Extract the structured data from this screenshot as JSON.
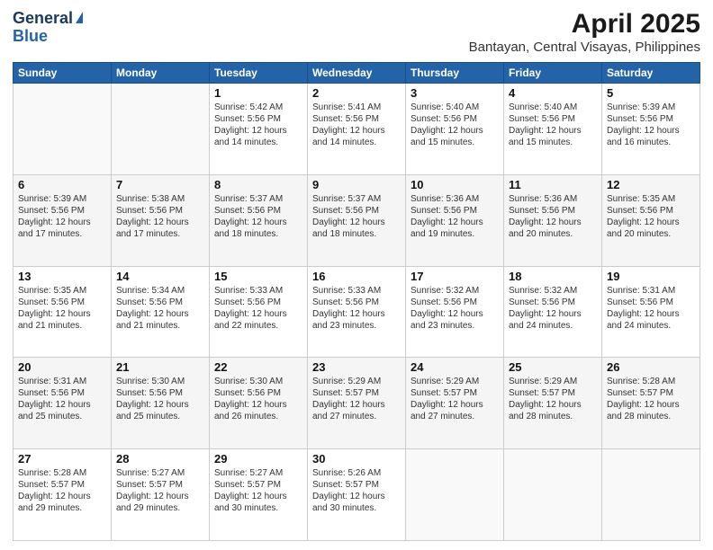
{
  "header": {
    "logo_general": "General",
    "logo_blue": "Blue",
    "title": "April 2025",
    "subtitle": "Bantayan, Central Visayas, Philippines"
  },
  "calendar": {
    "days_of_week": [
      "Sunday",
      "Monday",
      "Tuesday",
      "Wednesday",
      "Thursday",
      "Friday",
      "Saturday"
    ],
    "weeks": [
      [
        {
          "day": "",
          "info": ""
        },
        {
          "day": "",
          "info": ""
        },
        {
          "day": "1",
          "info": "Sunrise: 5:42 AM\nSunset: 5:56 PM\nDaylight: 12 hours\nand 14 minutes."
        },
        {
          "day": "2",
          "info": "Sunrise: 5:41 AM\nSunset: 5:56 PM\nDaylight: 12 hours\nand 14 minutes."
        },
        {
          "day": "3",
          "info": "Sunrise: 5:40 AM\nSunset: 5:56 PM\nDaylight: 12 hours\nand 15 minutes."
        },
        {
          "day": "4",
          "info": "Sunrise: 5:40 AM\nSunset: 5:56 PM\nDaylight: 12 hours\nand 15 minutes."
        },
        {
          "day": "5",
          "info": "Sunrise: 5:39 AM\nSunset: 5:56 PM\nDaylight: 12 hours\nand 16 minutes."
        }
      ],
      [
        {
          "day": "6",
          "info": "Sunrise: 5:39 AM\nSunset: 5:56 PM\nDaylight: 12 hours\nand 17 minutes."
        },
        {
          "day": "7",
          "info": "Sunrise: 5:38 AM\nSunset: 5:56 PM\nDaylight: 12 hours\nand 17 minutes."
        },
        {
          "day": "8",
          "info": "Sunrise: 5:37 AM\nSunset: 5:56 PM\nDaylight: 12 hours\nand 18 minutes."
        },
        {
          "day": "9",
          "info": "Sunrise: 5:37 AM\nSunset: 5:56 PM\nDaylight: 12 hours\nand 18 minutes."
        },
        {
          "day": "10",
          "info": "Sunrise: 5:36 AM\nSunset: 5:56 PM\nDaylight: 12 hours\nand 19 minutes."
        },
        {
          "day": "11",
          "info": "Sunrise: 5:36 AM\nSunset: 5:56 PM\nDaylight: 12 hours\nand 20 minutes."
        },
        {
          "day": "12",
          "info": "Sunrise: 5:35 AM\nSunset: 5:56 PM\nDaylight: 12 hours\nand 20 minutes."
        }
      ],
      [
        {
          "day": "13",
          "info": "Sunrise: 5:35 AM\nSunset: 5:56 PM\nDaylight: 12 hours\nand 21 minutes."
        },
        {
          "day": "14",
          "info": "Sunrise: 5:34 AM\nSunset: 5:56 PM\nDaylight: 12 hours\nand 21 minutes."
        },
        {
          "day": "15",
          "info": "Sunrise: 5:33 AM\nSunset: 5:56 PM\nDaylight: 12 hours\nand 22 minutes."
        },
        {
          "day": "16",
          "info": "Sunrise: 5:33 AM\nSunset: 5:56 PM\nDaylight: 12 hours\nand 23 minutes."
        },
        {
          "day": "17",
          "info": "Sunrise: 5:32 AM\nSunset: 5:56 PM\nDaylight: 12 hours\nand 23 minutes."
        },
        {
          "day": "18",
          "info": "Sunrise: 5:32 AM\nSunset: 5:56 PM\nDaylight: 12 hours\nand 24 minutes."
        },
        {
          "day": "19",
          "info": "Sunrise: 5:31 AM\nSunset: 5:56 PM\nDaylight: 12 hours\nand 24 minutes."
        }
      ],
      [
        {
          "day": "20",
          "info": "Sunrise: 5:31 AM\nSunset: 5:56 PM\nDaylight: 12 hours\nand 25 minutes."
        },
        {
          "day": "21",
          "info": "Sunrise: 5:30 AM\nSunset: 5:56 PM\nDaylight: 12 hours\nand 25 minutes."
        },
        {
          "day": "22",
          "info": "Sunrise: 5:30 AM\nSunset: 5:56 PM\nDaylight: 12 hours\nand 26 minutes."
        },
        {
          "day": "23",
          "info": "Sunrise: 5:29 AM\nSunset: 5:57 PM\nDaylight: 12 hours\nand 27 minutes."
        },
        {
          "day": "24",
          "info": "Sunrise: 5:29 AM\nSunset: 5:57 PM\nDaylight: 12 hours\nand 27 minutes."
        },
        {
          "day": "25",
          "info": "Sunrise: 5:29 AM\nSunset: 5:57 PM\nDaylight: 12 hours\nand 28 minutes."
        },
        {
          "day": "26",
          "info": "Sunrise: 5:28 AM\nSunset: 5:57 PM\nDaylight: 12 hours\nand 28 minutes."
        }
      ],
      [
        {
          "day": "27",
          "info": "Sunrise: 5:28 AM\nSunset: 5:57 PM\nDaylight: 12 hours\nand 29 minutes."
        },
        {
          "day": "28",
          "info": "Sunrise: 5:27 AM\nSunset: 5:57 PM\nDaylight: 12 hours\nand 29 minutes."
        },
        {
          "day": "29",
          "info": "Sunrise: 5:27 AM\nSunset: 5:57 PM\nDaylight: 12 hours\nand 30 minutes."
        },
        {
          "day": "30",
          "info": "Sunrise: 5:26 AM\nSunset: 5:57 PM\nDaylight: 12 hours\nand 30 minutes."
        },
        {
          "day": "",
          "info": ""
        },
        {
          "day": "",
          "info": ""
        },
        {
          "day": "",
          "info": ""
        }
      ]
    ]
  }
}
